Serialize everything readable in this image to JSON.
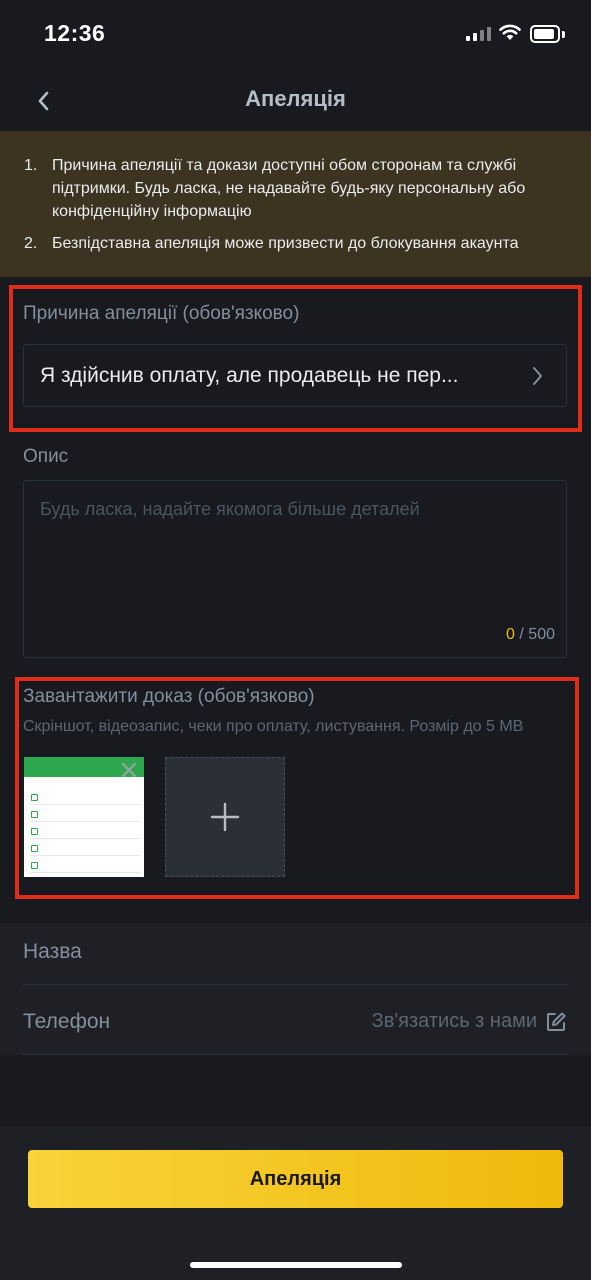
{
  "status_bar": {
    "time": "12:36"
  },
  "nav": {
    "title": "Апеляція",
    "back_icon": "chevron-left-icon"
  },
  "notice": {
    "items": [
      {
        "num": "1.",
        "text": "Причина апеляції та докази доступні обом сторонам та службі підтримки. Будь ласка, не надавайте будь-яку персональну або конфіденційну інформацію"
      },
      {
        "num": "2.",
        "text": "Безпідставна апеляція може призвести до блокування акаунта"
      }
    ]
  },
  "reason": {
    "label": "Причина апеляції (обов'язково)",
    "value": "Я здійснив оплату, але продавець не пер...",
    "icon": "chevron-right-icon"
  },
  "description": {
    "label": "Опис",
    "placeholder": "Будь ласка, надайте якомога більше деталей",
    "count": "0",
    "max": "/ 500"
  },
  "upload": {
    "label": "Завантажити доказ (обов'язково)",
    "hint": "Скріншот, відеозапис, чеки про оплату, листування. Розмір до 5 MB",
    "add_icon": "plus-icon",
    "remove_icon": "close-icon"
  },
  "info": {
    "name_label": "Назва",
    "phone_label": "Телефон",
    "contact_label": "Зв'язатись з нами",
    "contact_icon": "edit-icon"
  },
  "submit": {
    "label": "Апеляція"
  },
  "colors": {
    "background": "#181a20",
    "notice_bg": "#3c3320",
    "accent": "#f0b90b",
    "highlight_frame": "#e02d1a"
  }
}
